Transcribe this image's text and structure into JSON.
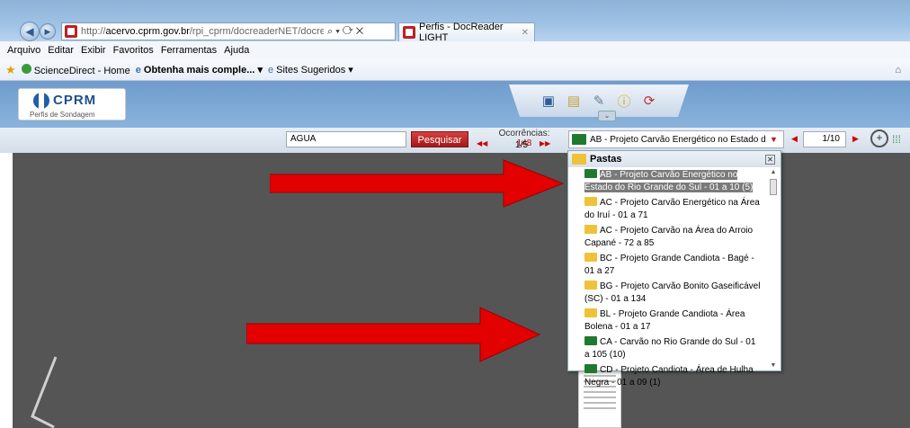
{
  "browser": {
    "url_domain": "acervo.cprm.gov.br",
    "url_rest": "/rpi_cprm/docreaderNET/docreader.aspx?bi",
    "url_scheme": "http://",
    "address_icons": "⌕ ▾ ⟳ ✕",
    "tab_title": "Perfis - DocReader LIGHT",
    "tab_close": "✕",
    "back_icon": "back-arrow-icon",
    "forward_icon": "forward-arrow-icon"
  },
  "menu": [
    "Arquivo",
    "Editar",
    "Exibir",
    "Favoritos",
    "Ferramentas",
    "Ajuda"
  ],
  "favorites": {
    "item1": "ScienceDirect - Home",
    "item2": "Obtenha mais comple...",
    "item2_arrow": "▾",
    "item3": "Sites Sugeridos",
    "item3_arrow": "▾"
  },
  "logo": {
    "name": "CPRM",
    "subtitle": "Perfis de Sondagem"
  },
  "toolbox": {
    "icons": [
      "save-icon",
      "book-icon",
      "tools-icon",
      "info-icon",
      "refresh-icon"
    ]
  },
  "search": {
    "value": "AGUA",
    "button": "Pesquisar",
    "occurrences_label": "Ocorrências:",
    "occurrences_count": "148",
    "occurrences_page": "1/5"
  },
  "folder_select": {
    "value": "AB - Projeto Carvão Energético no Estado do Rio Gra",
    "arrow": "▼"
  },
  "paging": {
    "value": "1/10"
  },
  "pastas": {
    "title": "Pastas",
    "items": [
      {
        "text": "AB - Projeto Carvão Energético no Estado do Rio Grande do Sul - 01 a 10 (5)",
        "color": "green",
        "selected": true
      },
      {
        "text": "AC - Projeto Carvão Energético na Área do Iruí - 01 a 71",
        "color": "yellow",
        "selected": false
      },
      {
        "text": "AC - Projeto Carvão na Área do Arroio Capané - 72 a 85",
        "color": "yellow",
        "selected": false
      },
      {
        "text": "BC - Projeto Grande Candiota - Bagé - 01 a 27",
        "color": "yellow",
        "selected": false
      },
      {
        "text": "BG - Projeto Carvão Bonito Gaseificável (SC) - 01 a 134",
        "color": "yellow",
        "selected": false
      },
      {
        "text": "BL - Projeto Grande Candiota - Área Bolena - 01 a 17",
        "color": "yellow",
        "selected": false
      },
      {
        "text": "CA - Carvão no Rio Grande do Sul - 01 a 105 (10)",
        "color": "green",
        "selected": false
      },
      {
        "text": "CD - Projeto Candiota - Área de Hulha Negra - 01 a 09 (1)",
        "color": "green",
        "selected": false
      }
    ]
  },
  "colors": {
    "accent_red": "#cc0000",
    "folder_green": "#1f7a2e",
    "folder_yellow": "#f0c23a"
  }
}
